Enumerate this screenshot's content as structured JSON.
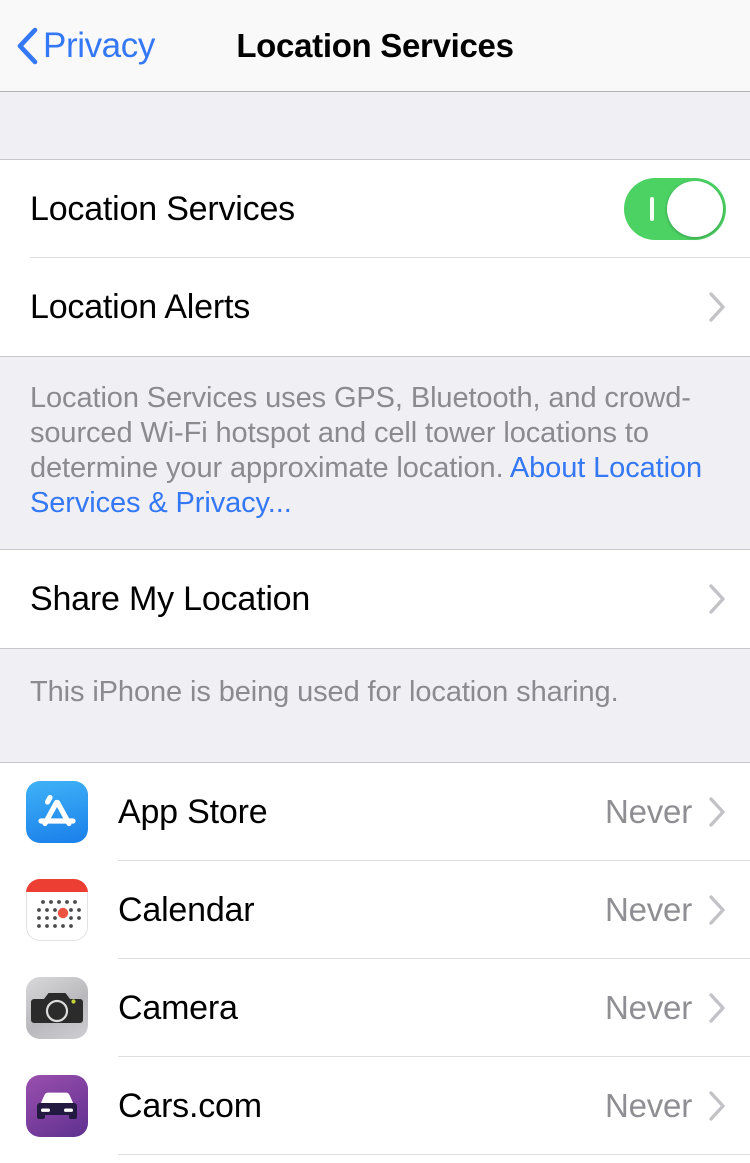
{
  "nav": {
    "back_label": "Privacy",
    "back_icon": "chevron-left-icon",
    "title": "Location Services"
  },
  "colors": {
    "accent_blue": "#3478f6",
    "toggle_on_green": "#4cd263",
    "group_background": "#efeff4",
    "separator": "#c8c7cc",
    "secondary_text": "#8e8e93",
    "footer_text": "#8a8a8f"
  },
  "settings_group": {
    "rows": [
      {
        "label": "Location Services",
        "control": "toggle",
        "toggle_state": "on"
      },
      {
        "label": "Location Alerts",
        "control": "chevron"
      }
    ]
  },
  "footer_primary": {
    "text": "Location Services uses GPS, Bluetooth, and crowd-sourced Wi-Fi hotspot and cell tower locations to determine your approximate location. ",
    "link_text": "About Location Services & Privacy..."
  },
  "share_group": {
    "rows": [
      {
        "label": "Share My Location",
        "control": "chevron"
      }
    ]
  },
  "footer_share": {
    "text": "This iPhone is being used for location sharing."
  },
  "apps_group": {
    "rows": [
      {
        "name": "App Store",
        "value": "Never",
        "icon": "app-store-icon"
      },
      {
        "name": "Calendar",
        "value": "Never",
        "icon": "calendar-icon"
      },
      {
        "name": "Camera",
        "value": "Never",
        "icon": "camera-icon"
      },
      {
        "name": "Cars.com",
        "value": "Never",
        "icon": "cars-com-icon"
      }
    ]
  }
}
